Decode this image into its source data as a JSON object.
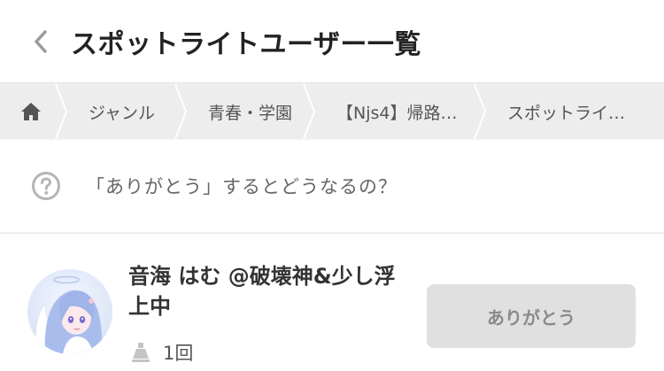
{
  "header": {
    "title": "スポットライトユーザー一覧",
    "back_icon": "chevron-left-icon"
  },
  "breadcrumb": {
    "home_icon": "home-icon",
    "items": [
      "ジャンル",
      "青春・学園",
      "【Njs4】帰路…",
      "スポットライ…"
    ]
  },
  "info": {
    "icon": "question-circle-icon",
    "text": "「ありがとう」するとどうなるの？"
  },
  "user": {
    "name": "音海 はむ @破壊神&少し浮上中",
    "count": "1回",
    "count_icon": "spotlight-icon",
    "avatar": "avatar-image",
    "thanks_label": "ありがとう"
  },
  "colors": {
    "header_bg": "#ffffff",
    "breadcrumb_bg": "#ededed",
    "button_bg": "#e0e0e0",
    "button_text": "#8a8a8a"
  }
}
